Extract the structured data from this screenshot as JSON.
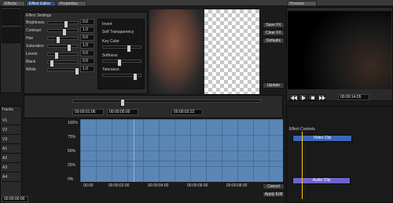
{
  "top_tabs": [
    "Effects",
    "Effect Editor",
    "Properties",
    "Preview"
  ],
  "effect_panel_title": "Effect Settings",
  "right_buttons": [
    "Save FX",
    "Clear FX",
    "Defaults",
    "Update"
  ],
  "params": [
    {
      "label": "Brightness",
      "value": "0.0"
    },
    {
      "label": "Contrast",
      "value": "1.0"
    },
    {
      "label": "Hue",
      "value": "0.0"
    },
    {
      "label": "Saturation",
      "value": "1.0"
    },
    {
      "label": "Levels",
      "value": "0.0"
    },
    {
      "label": "Black",
      "value": "0.0"
    },
    {
      "label": "White",
      "value": "1.0"
    }
  ],
  "key_params": [
    {
      "label": "Invert"
    },
    {
      "label": "Self Transparency"
    },
    {
      "label": "Key Color"
    },
    {
      "label": "Softness"
    },
    {
      "label": "Tolerance"
    }
  ],
  "timeline": {
    "timecodes": [
      "00:00:01:06",
      "00:00:00:00",
      "00:00:02:22"
    ],
    "preview_time": "00:00:14:05",
    "ruler": [
      "00:00",
      "00:00:02:00",
      "00:00:04:00",
      "00:00:06:00",
      "00:00:08:00"
    ],
    "graph_y_labels": [
      "100%",
      "75%",
      "50%",
      "25%",
      "0%"
    ]
  },
  "left_panel_labels": [
    "Tracks",
    "V1",
    "V2",
    "V3",
    "A1",
    "A2",
    "A3",
    "A4"
  ],
  "bottom_right_buttons": [
    "Cancel",
    "Apply Edit"
  ],
  "sequence_labels": {
    "track_header": "Effect Controls",
    "clip_video": "Video Clip",
    "clip_audio": "Audio Clip"
  },
  "bottom_status": "00:00:00:00",
  "colors": {
    "accent_blue": "#2f4f8f",
    "graph_blue": "#5a86b6",
    "clip_blue": "#3d66b8",
    "clip_purple": "#6f64c9"
  },
  "icons": [
    "play-icon",
    "pause-icon",
    "stop-icon",
    "rewind-icon",
    "forward-icon",
    "gear-icon"
  ]
}
